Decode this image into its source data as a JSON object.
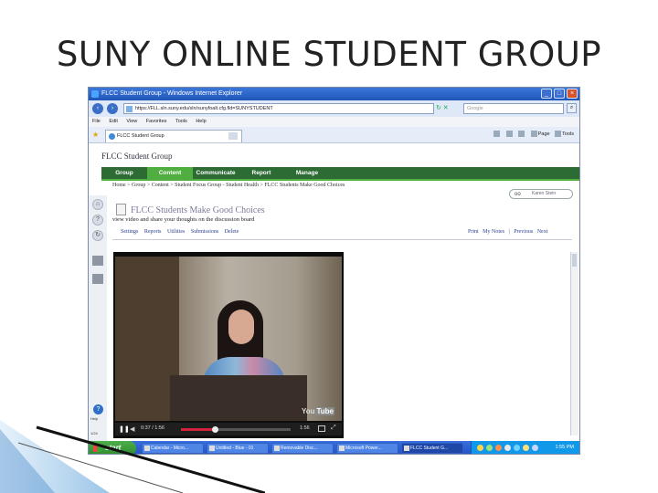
{
  "slide": {
    "title": "SUNY ONLINE STUDENT GROUP"
  },
  "browser": {
    "window_title": "FLCC Student Group - Windows Internet Explorer",
    "address": "https://FLL.sln.suny.edu/sln/sunyfoalt.cfg.fld=SUNYSTUDENT",
    "search_placeholder": "Google",
    "menu": [
      "File",
      "Edit",
      "View",
      "Favorites",
      "Tools",
      "Help"
    ],
    "tab_label": "FLCC Student Group",
    "toolbar": {
      "page_label": "Page",
      "tools_label": "Tools"
    }
  },
  "lms": {
    "site_title": "FLCC Student Group",
    "nav": [
      "Group",
      "Content",
      "Communicate",
      "Report",
      "Manage"
    ],
    "breadcrumb": "Home > Group > Content > Student Focus Group - Student Health > FLCC Students Make Good Choices",
    "user_pill": "Karen Stein",
    "page_heading": "FLCC Students Make Good Choices",
    "page_desc": "view video and share your thoughts on the discussion board",
    "actions": [
      "Settings",
      "Reports",
      "Utilities",
      "Submissions",
      "Delete"
    ],
    "right_links": [
      "Print",
      "My Notes",
      "|",
      "Previous",
      "Next"
    ]
  },
  "sidebar": {
    "help_label": "Help",
    "status_label": "1/24"
  },
  "video": {
    "time_current": "0:37 / 1:56",
    "duration": "1:56",
    "progress": 0.31,
    "watermark_you": "You",
    "watermark_tube": "Tube"
  },
  "taskbar": {
    "start_label": "start",
    "items": [
      "Calendar - Micro...",
      "Untitled - Blue - 01",
      "Removable Disc...",
      "Microsoft Power...",
      "FLCC Student G..."
    ],
    "active_index": 4,
    "clock": "1:55 PM"
  },
  "colors": {
    "lms_nav": "#2d6b35",
    "lms_nav_active": "#4fae3f",
    "taskbar": "#2150c5",
    "start_button": "#3a9e38"
  }
}
